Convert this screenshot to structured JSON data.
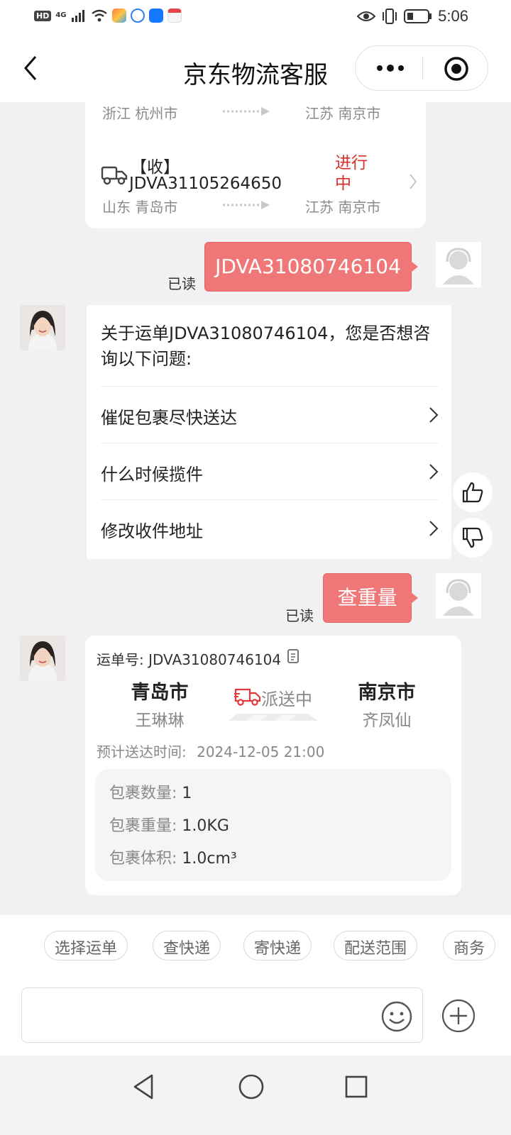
{
  "status_bar": {
    "hd_tag": "HD",
    "network": "4G",
    "time": "5:06"
  },
  "nav": {
    "title": "京东物流客服"
  },
  "prev_card": {
    "row1_from": "浙江 杭州市",
    "row1_to": "江苏 南京市",
    "waybill_label": "【收】",
    "waybill_number": "JDVA31105264650",
    "status": "进行中",
    "row2_from": "山东 青岛市",
    "row2_to": "江苏 南京市"
  },
  "messages": {
    "user_msg1": "JDVA31080746104",
    "read1": "已读",
    "bot_question": "关于运单JDVA31080746104，您是否想咨询以下问题:",
    "options": [
      "催促包裹尽快送达",
      "什么时候揽件",
      "修改收件地址"
    ],
    "user_msg2": "查重量",
    "read2": "已读"
  },
  "tracking": {
    "waybill_label": "运单号:",
    "waybill_number": "JDVA31080746104",
    "from_city": "青岛市",
    "from_person": "王琳琳",
    "status": "派送中",
    "to_city": "南京市",
    "to_person": "齐凤仙",
    "eta_label": "预计送达时间:",
    "eta": "2024-12-05 21:00",
    "count_label": "包裹数量:",
    "count": "1",
    "weight_label": "包裹重量:",
    "weight": "1.0KG",
    "volume_label": "包裹体积:",
    "volume": "1.0cm³"
  },
  "quick_replies": [
    "选择运单",
    "查快递",
    "寄快递",
    "配送范围",
    "商务"
  ],
  "colors": {
    "accent": "#f07777",
    "status_red": "#d9302a",
    "background": "#f1f1f3"
  },
  "icons": [
    "back-icon",
    "more-icon",
    "target-icon",
    "truck-icon",
    "chevron-right-icon",
    "thumbs-up-icon",
    "thumbs-down-icon",
    "copy-icon",
    "delivery-truck-icon",
    "emoji-icon",
    "plus-icon",
    "nav-back-icon",
    "nav-home-icon",
    "nav-recents-icon"
  ]
}
